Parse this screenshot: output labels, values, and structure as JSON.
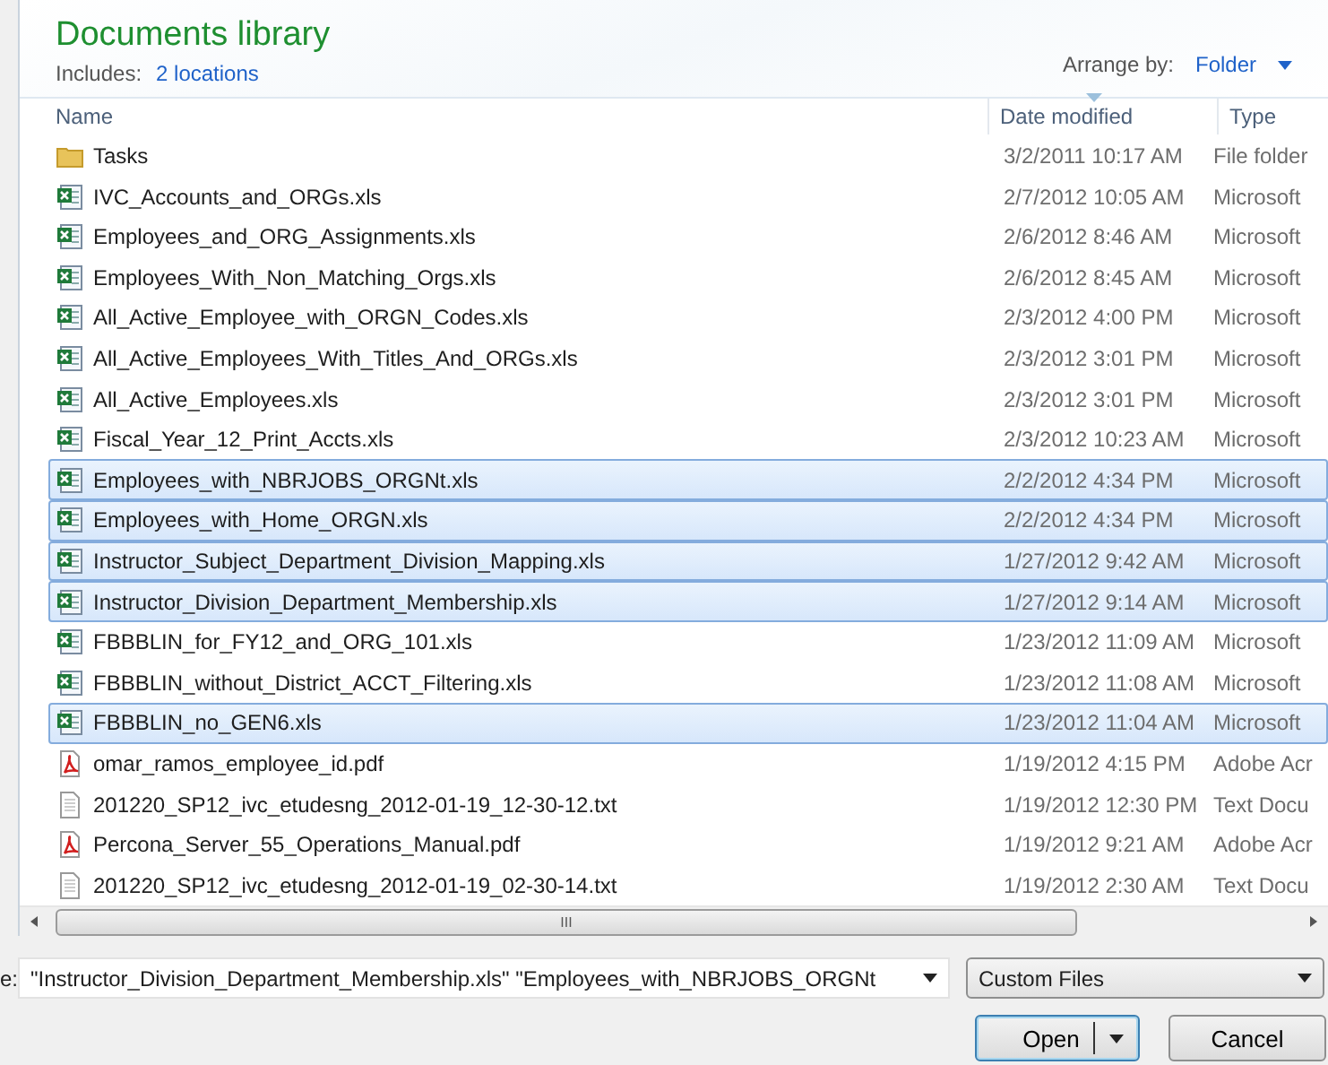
{
  "library": {
    "title": "Documents library",
    "includes_label": "Includes:",
    "locations_link": "2 locations",
    "arrange_label": "Arrange by:",
    "arrange_value": "Folder"
  },
  "columns": [
    {
      "label": "Name",
      "sorted": false
    },
    {
      "label": "Date modified",
      "sorted": true
    },
    {
      "label": "Type",
      "sorted": false
    }
  ],
  "files": [
    {
      "kind": "folder",
      "name": "Tasks",
      "date": "3/2/2011 10:17 AM",
      "type": "File folder",
      "selected": false
    },
    {
      "kind": "excel",
      "name": "IVC_Accounts_and_ORGs.xls",
      "date": "2/7/2012 10:05 AM",
      "type": "Microsoft",
      "selected": false
    },
    {
      "kind": "excel",
      "name": "Employees_and_ORG_Assignments.xls",
      "date": "2/6/2012 8:46 AM",
      "type": "Microsoft",
      "selected": false
    },
    {
      "kind": "excel",
      "name": "Employees_With_Non_Matching_Orgs.xls",
      "date": "2/6/2012 8:45 AM",
      "type": "Microsoft",
      "selected": false
    },
    {
      "kind": "excel",
      "name": "All_Active_Employee_with_ORGN_Codes.xls",
      "date": "2/3/2012 4:00 PM",
      "type": "Microsoft",
      "selected": false
    },
    {
      "kind": "excel",
      "name": "All_Active_Employees_With_Titles_And_ORGs.xls",
      "date": "2/3/2012 3:01 PM",
      "type": "Microsoft",
      "selected": false
    },
    {
      "kind": "excel",
      "name": "All_Active_Employees.xls",
      "date": "2/3/2012 3:01 PM",
      "type": "Microsoft",
      "selected": false
    },
    {
      "kind": "excel",
      "name": "Fiscal_Year_12_Print_Accts.xls",
      "date": "2/3/2012 10:23 AM",
      "type": "Microsoft",
      "selected": false
    },
    {
      "kind": "excel",
      "name": "Employees_with_NBRJOBS_ORGNt.xls",
      "date": "2/2/2012 4:34 PM",
      "type": "Microsoft",
      "selected": true
    },
    {
      "kind": "excel",
      "name": "Employees_with_Home_ORGN.xls",
      "date": "2/2/2012 4:34 PM",
      "type": "Microsoft",
      "selected": true
    },
    {
      "kind": "excel",
      "name": "Instructor_Subject_Department_Division_Mapping.xls",
      "date": "1/27/2012 9:42 AM",
      "type": "Microsoft",
      "selected": true
    },
    {
      "kind": "excel",
      "name": "Instructor_Division_Department_Membership.xls",
      "date": "1/27/2012 9:14 AM",
      "type": "Microsoft",
      "selected": true
    },
    {
      "kind": "excel",
      "name": "FBBBLIN_for_FY12_and_ORG_101.xls",
      "date": "1/23/2012 11:09 AM",
      "type": "Microsoft",
      "selected": false
    },
    {
      "kind": "excel",
      "name": "FBBBLIN_without_District_ACCT_Filtering.xls",
      "date": "1/23/2012 11:08 AM",
      "type": "Microsoft",
      "selected": false
    },
    {
      "kind": "excel",
      "name": "FBBBLIN_no_GEN6.xls",
      "date": "1/23/2012 11:04 AM",
      "type": "Microsoft",
      "selected": true
    },
    {
      "kind": "pdf",
      "name": "omar_ramos_employee_id.pdf",
      "date": "1/19/2012 4:15 PM",
      "type": "Adobe Acr",
      "selected": false
    },
    {
      "kind": "text",
      "name": "201220_SP12_ivc_etudesng_2012-01-19_12-30-12.txt",
      "date": "1/19/2012 12:30 PM",
      "type": "Text Docu",
      "selected": false
    },
    {
      "kind": "pdf",
      "name": "Percona_Server_55_Operations_Manual.pdf",
      "date": "1/19/2012 9:21 AM",
      "type": "Adobe Acr",
      "selected": false
    },
    {
      "kind": "text",
      "name": "201220_SP12_ivc_etudesng_2012-01-19_02-30-14.txt",
      "date": "1/19/2012 2:30 AM",
      "type": "Text Docu",
      "selected": false
    }
  ],
  "scrollbar_grip": "III",
  "file_name": {
    "label": "e:",
    "value": "\"Instructor_Division_Department_Membership.xls\" \"Employees_with_NBRJOBS_ORGNt"
  },
  "file_type": {
    "value": "Custom Files"
  },
  "buttons": [
    {
      "kind": "split",
      "label": "Open",
      "default": true
    },
    {
      "kind": "plain",
      "label": "Cancel",
      "default": false
    }
  ]
}
